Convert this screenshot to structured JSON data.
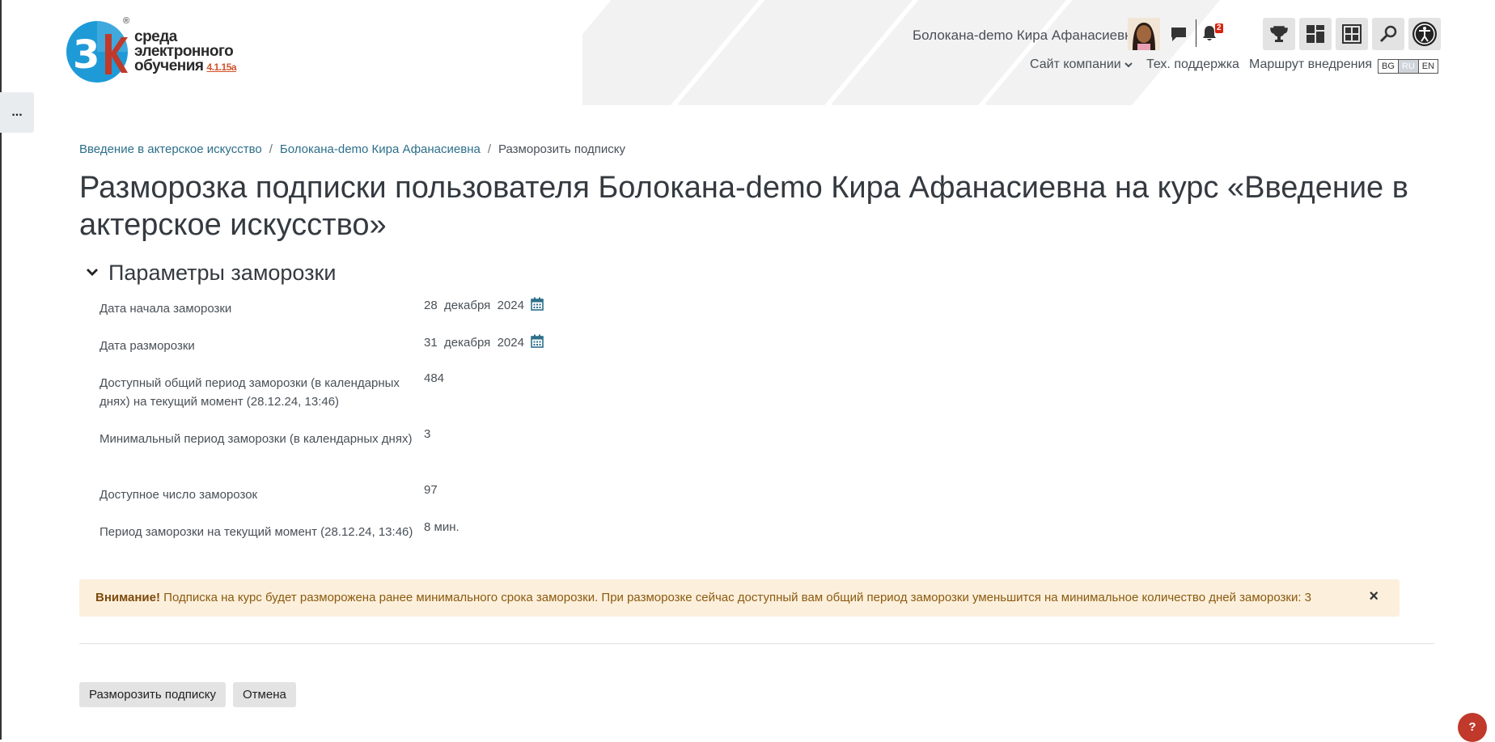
{
  "logo": {
    "line1": "среда",
    "line2": "электронного",
    "line3": "обучения",
    "version": "4.1.15a",
    "mark": "3k",
    "reg": "®"
  },
  "header": {
    "user_name": "Болокана-demo Кира Афанасиевна",
    "notification_count": "2",
    "nav": {
      "company": "Сайт компании",
      "support": "Тех. поддержка",
      "route": "Маршрут внедрения"
    },
    "languages": [
      "BG",
      "RU",
      "EN"
    ],
    "active_language": "RU",
    "toolbar_icons": [
      "trophy-icon",
      "dashboard-icon",
      "calendar-grid-icon",
      "search-icon",
      "accessibility-icon"
    ]
  },
  "drawer": {
    "label": "..."
  },
  "breadcrumb": {
    "course": "Введение в актерское искусство",
    "user": "Болокана-demo Кира Афанасиевна",
    "current": "Разморозить подписку",
    "separator": "/"
  },
  "page": {
    "title": "Разморозка подписки пользователя Болокана-demo Кира Афанасиевна на курс «Введение в актерское искусство»"
  },
  "section": {
    "title": "Параметры заморозки",
    "fields": {
      "start": {
        "label": "Дата начала заморозки",
        "day": "28",
        "month": "декабря",
        "year": "2024"
      },
      "end": {
        "label": "Дата разморозки",
        "day": "31",
        "month": "декабря",
        "year": "2024"
      },
      "available_total": {
        "label": "Доступный общий период заморозки (в календарных днях) на текущий момент (28.12.24, 13:46)",
        "value": "484"
      },
      "min_period": {
        "label": "Минимальный период заморозки (в календарных днях)",
        "value": "3"
      },
      "count": {
        "label": "Доступное число заморозок",
        "value": "97"
      },
      "current_period": {
        "label": "Период заморозки на текущий момент (28.12.24, 13:46)",
        "value": "8 мин."
      }
    }
  },
  "alert": {
    "strong": "Внимание!",
    "text": "Подписка на курс будет разморожена ранее минимального срока заморозки. При разморозке сейчас доступный вам общий период заморозки уменьшится на минимальное количество дней заморозки: 3",
    "close": "×"
  },
  "buttons": {
    "submit": "Разморозить подписку",
    "cancel": "Отмена"
  },
  "help": {
    "label": "?"
  },
  "colors": {
    "accent_link": "#2c6f8a",
    "alert_bg": "#fcefdc",
    "alert_text": "#8a5b0f",
    "badge": "#d9230f",
    "logo_blue": "#1e9bd7",
    "logo_red": "#c0392b"
  }
}
